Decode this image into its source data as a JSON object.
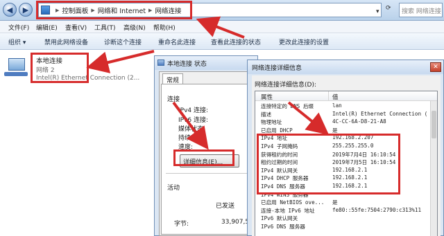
{
  "explorer": {
    "breadcrumbs": [
      "控制面板",
      "网络和 Internet",
      "网络连接"
    ],
    "search_placeholder": "搜索 网络连接"
  },
  "menu": {
    "items": [
      "文件(F)",
      "编辑(E)",
      "查看(V)",
      "工具(T)",
      "高级(N)",
      "帮助(H)"
    ]
  },
  "commands": {
    "items": [
      "组织 ▾",
      "禁用此网络设备",
      "诊断这个连接",
      "重命名此连接",
      "查看此连接的状态",
      "更改此连接的设置"
    ]
  },
  "adapter": {
    "name": "本地连接",
    "network": "网络 2",
    "device": "Intel(R) Ethernet Connection (2..."
  },
  "status_dialog": {
    "title": "本地连接 状态",
    "tab": "常规",
    "section_connection": "连接",
    "rows": [
      "IPv4 连接:",
      "IPv6 连接:",
      "媒体状态:",
      "持续时间:",
      "速度:"
    ],
    "details_button": "详细信息(E)...",
    "section_activity": "活动",
    "sent_label": "已发送",
    "bytes_label": "字节:",
    "bytes_sent": "33,907,5"
  },
  "details_dialog": {
    "title": "网络连接详细信息",
    "list_label": "网络连接详细信息(D):",
    "col_property": "属性",
    "col_value": "值",
    "rows": [
      {
        "p": "连接特定的 DNS 后缀",
        "v": "lan"
      },
      {
        "p": "描述",
        "v": "Intel(R) Ethernet Connection ("
      },
      {
        "p": "物理地址",
        "v": "4C-CC-6A-D8-21-A8"
      },
      {
        "p": "已启用 DHCP",
        "v": "是"
      },
      {
        "p": "IPv4 地址",
        "v": "192.168.2.207"
      },
      {
        "p": "IPv4 子网掩码",
        "v": "255.255.255.0"
      },
      {
        "p": "获得租约的时间",
        "v": "2019年7月4日 16:10:54"
      },
      {
        "p": "租约过期的时间",
        "v": "2019年7月5日 16:10:54"
      },
      {
        "p": "IPv4 默认网关",
        "v": "192.168.2.1"
      },
      {
        "p": "IPv4 DHCP 服务器",
        "v": "192.168.2.1"
      },
      {
        "p": "IPv4 DNS 服务器",
        "v": "192.168.2.1"
      },
      {
        "p": "IPv4 WINS 服务器",
        "v": ""
      },
      {
        "p": "已启用 NetBIOS ove...",
        "v": "是"
      },
      {
        "p": "连接-本地 IPv6 地址",
        "v": "fe80::55fe:7504:2790:c313%11"
      },
      {
        "p": "IPv6 默认网关",
        "v": ""
      },
      {
        "p": "IPv6 DNS 服务器",
        "v": ""
      }
    ]
  },
  "colors": {
    "annotation_red": "#d62b2b"
  }
}
